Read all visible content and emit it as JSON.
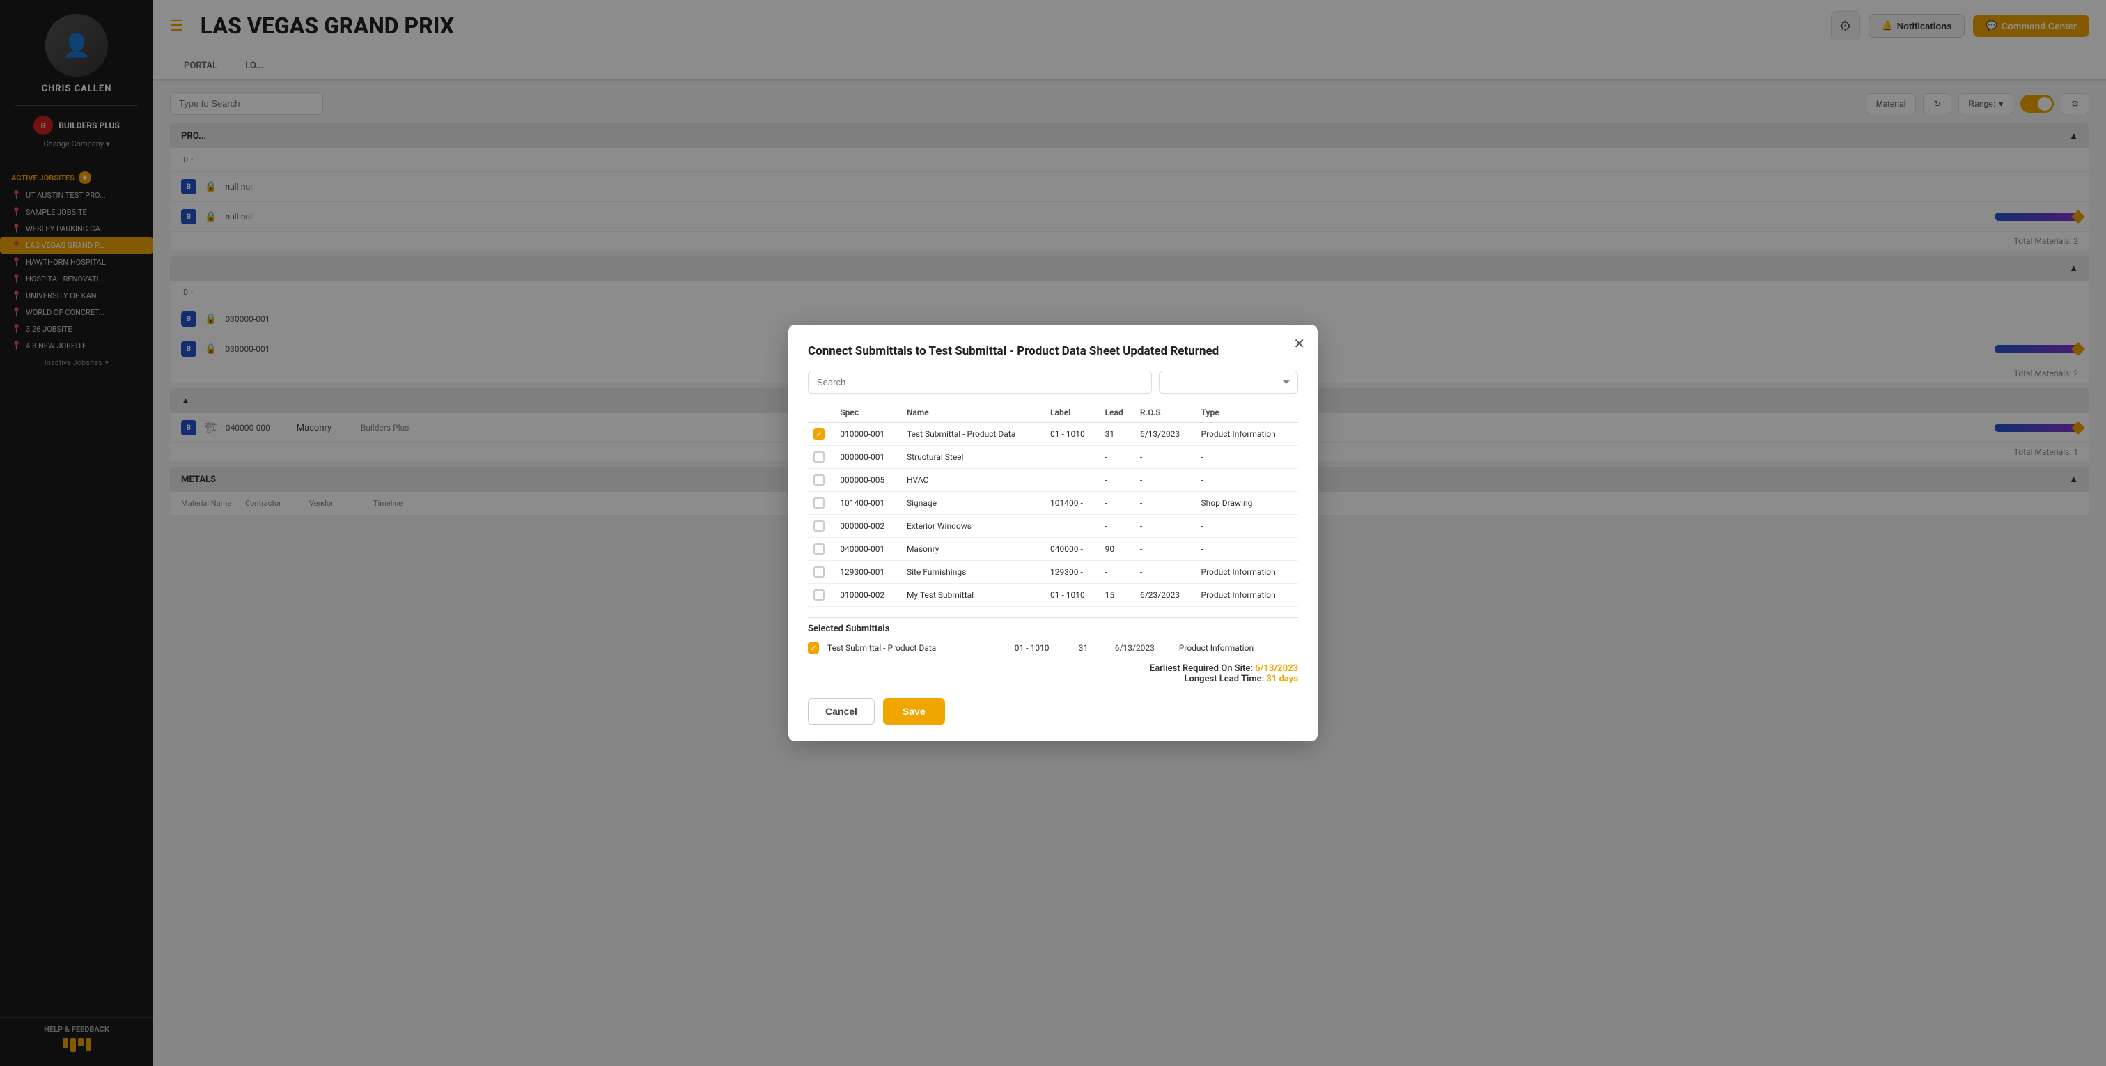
{
  "sidebar": {
    "user_name": "CHRIS CALLEN",
    "company": {
      "name": "BUILDERS PLUS",
      "change_label": "Change Company"
    },
    "active_jobsites_label": "ACTIVE JOBSITES",
    "jobsites": [
      {
        "name": "UT AUSTIN TEST PRO...",
        "active": false
      },
      {
        "name": "SAMPLE JOBSITE",
        "active": false
      },
      {
        "name": "WESLEY PARKING GA...",
        "active": false
      },
      {
        "name": "LAS VEGAS GRAND P...",
        "active": true
      },
      {
        "name": "HAWTHORN HOSPITAL",
        "active": false
      },
      {
        "name": "HOSPITAL RENOVATI...",
        "active": false
      },
      {
        "name": "UNIVERSITY OF KAN...",
        "active": false
      },
      {
        "name": "WORLD OF CONCRET...",
        "active": false
      },
      {
        "name": "3.26 JOBSITE",
        "active": false
      },
      {
        "name": "4.3 NEW JOBSITE",
        "active": false
      }
    ],
    "inactive_label": "Inactive Jobsites",
    "help_label": "HELP & FEEDBACK"
  },
  "header": {
    "title": "LAS VEGAS GRAND PRIX",
    "notifications_label": "Notifications",
    "command_center_label": "Command Center"
  },
  "nav_tabs": [
    {
      "label": "PORTAL",
      "active": false
    },
    {
      "label": "LO...",
      "active": false
    }
  ],
  "toolbar": {
    "search_placeholder": "Type to Search",
    "material_label": "Material",
    "range_label": "Range:"
  },
  "modal": {
    "title": "Connect Submittals to Test Submittal - Product Data Sheet Updated Returned",
    "search_placeholder": "Search",
    "filter_placeholder": "",
    "table_headers": [
      "Spec",
      "Name",
      "Label",
      "Lead",
      "R.O.S",
      "Type"
    ],
    "rows": [
      {
        "checked": true,
        "spec": "010000-001",
        "name": "Test Submittal - Product Data",
        "label": "01 - 1010",
        "lead": "31",
        "ros": "6/13/2023",
        "type": "Product Information"
      },
      {
        "checked": false,
        "spec": "000000-001",
        "name": "Structural Steel",
        "label": "",
        "lead": "-",
        "ros": "-",
        "type": "-"
      },
      {
        "checked": false,
        "spec": "000000-005",
        "name": "HVAC",
        "label": "",
        "lead": "-",
        "ros": "-",
        "type": "-"
      },
      {
        "checked": false,
        "spec": "101400-001",
        "name": "Signage",
        "label": "101400 -",
        "lead": "-",
        "ros": "-",
        "type": "Shop Drawing"
      },
      {
        "checked": false,
        "spec": "000000-002",
        "name": "Exterior Windows",
        "label": "",
        "lead": "-",
        "ros": "-",
        "type": "-"
      },
      {
        "checked": false,
        "spec": "040000-001",
        "name": "Masonry",
        "label": "040000 -",
        "lead": "90",
        "ros": "-",
        "type": "-"
      },
      {
        "checked": false,
        "spec": "129300-001",
        "name": "Site Furnishings",
        "label": "129300 -",
        "lead": "-",
        "ros": "-",
        "type": "Product Information"
      },
      {
        "checked": false,
        "spec": "010000-002",
        "name": "My Test Submittal",
        "label": "01 - 1010",
        "lead": "15",
        "ros": "6/23/2023",
        "type": "Product Information"
      }
    ],
    "selected_label": "Selected Submittals",
    "selected_rows": [
      {
        "checked": true,
        "name": "Test Submittal - Product Data",
        "label": "01 - 1010",
        "lead": "31",
        "ros": "6/13/2023",
        "type": "Product Information"
      }
    ],
    "earliest_required_label": "Earliest Required On Site:",
    "earliest_required_date": "6/13/2023",
    "longest_lead_label": "Longest Lead Time:",
    "longest_lead_days": "31 days",
    "cancel_label": "Cancel",
    "save_label": "Save"
  },
  "background_rows": {
    "section1_label": "PRO...",
    "row1_id": "null-null",
    "row2_id": "null-null",
    "section2_label": "",
    "row3_id": "030000-001",
    "row4_id": "030000-001",
    "section3_masonry": "Masonry",
    "section3_id": "040000-000",
    "section4_label": "METALS",
    "total_materials": "Total Materials: 2"
  }
}
